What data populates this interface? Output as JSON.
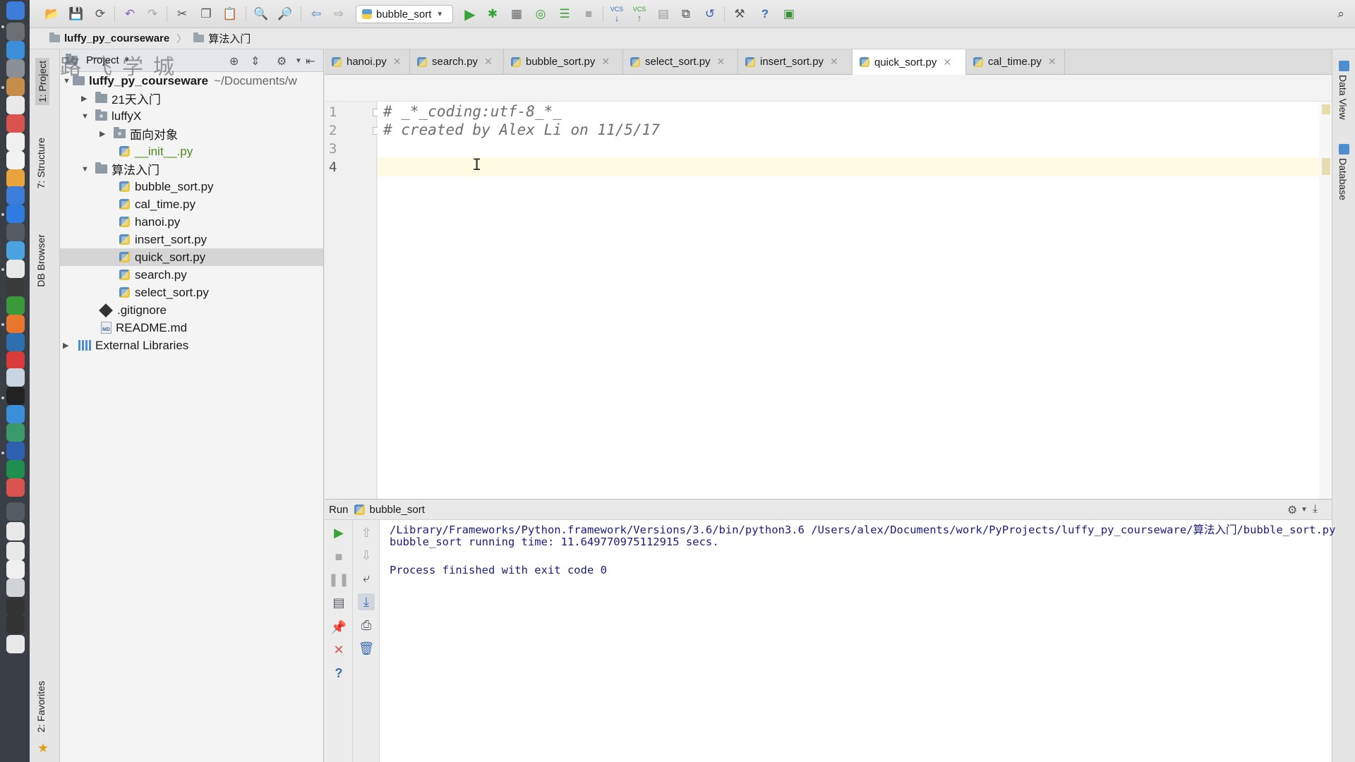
{
  "toolbar": {
    "run_config": "bubble_sort",
    "icons": [
      "open-icon",
      "save-icon",
      "sync-icon",
      "undo-icon",
      "redo-icon",
      "cut-icon",
      "copy-icon",
      "paste-icon",
      "find-icon",
      "replace-icon",
      "back-icon",
      "forward-icon",
      "run-icon",
      "debug-icon",
      "coverage-icon",
      "profile-icon",
      "run-list-icon",
      "stop-icon",
      "vcs-update-icon",
      "vcs-commit-icon",
      "history-icon",
      "compare-icon",
      "revert-icon",
      "settings-icon",
      "help-icon",
      "external-icon",
      "search-everywhere-icon"
    ],
    "vcs_label": "VCS"
  },
  "breadcrumb": [
    "luffy_py_courseware",
    "算法入门"
  ],
  "left_strip": {
    "project": "1: Project",
    "structure": "7: Structure",
    "db_browser": "DB Browser",
    "favorites": "2: Favorites"
  },
  "project_panel": {
    "title": "Project",
    "watermark": "路飞学城",
    "root": {
      "name": "luffy_py_courseware",
      "path": "~/Documents/w"
    },
    "items": [
      {
        "label": "21天入门"
      },
      {
        "label": "luffyX"
      },
      {
        "label": "面向对象"
      },
      {
        "label": "__init__.py"
      },
      {
        "label": "算法入门"
      },
      {
        "label": "bubble_sort.py"
      },
      {
        "label": "cal_time.py"
      },
      {
        "label": "hanoi.py"
      },
      {
        "label": "insert_sort.py"
      },
      {
        "label": "quick_sort.py"
      },
      {
        "label": "search.py"
      },
      {
        "label": "select_sort.py"
      },
      {
        "label": ".gitignore"
      },
      {
        "label": "README.md"
      },
      {
        "label": "External Libraries"
      }
    ],
    "selected": "quick_sort.py"
  },
  "editor": {
    "tabs": [
      {
        "label": "hanoi.py"
      },
      {
        "label": "search.py"
      },
      {
        "label": "bubble_sort.py"
      },
      {
        "label": "select_sort.py"
      },
      {
        "label": "insert_sort.py"
      },
      {
        "label": "quick_sort.py"
      },
      {
        "label": "cal_time.py"
      }
    ],
    "active_tab": "quick_sort.py",
    "line_numbers": [
      "1",
      "2",
      "3",
      "4"
    ],
    "lines": [
      "# _*_coding:utf-8_*_",
      "# created by Alex Li on 11/5/17",
      "",
      ""
    ],
    "current_line": 4
  },
  "right_strip": {
    "data_view": "Data View",
    "database": "Database"
  },
  "run_panel": {
    "label": "Run",
    "config": "bubble_sort",
    "output": [
      "/Library/Frameworks/Python.framework/Versions/3.6/bin/python3.6 /Users/alex/Documents/work/PyProjects/luffy_py_courseware/算法入门/bubble_sort.py",
      "bubble_sort running time: 11.649770975112915 secs.",
      "",
      "Process finished with exit code 0"
    ]
  },
  "colors": {
    "accent_green": "#37a235",
    "stop_red": "#d9534f",
    "console_text": "#1b1b80",
    "comment": "#6f6f6f"
  }
}
